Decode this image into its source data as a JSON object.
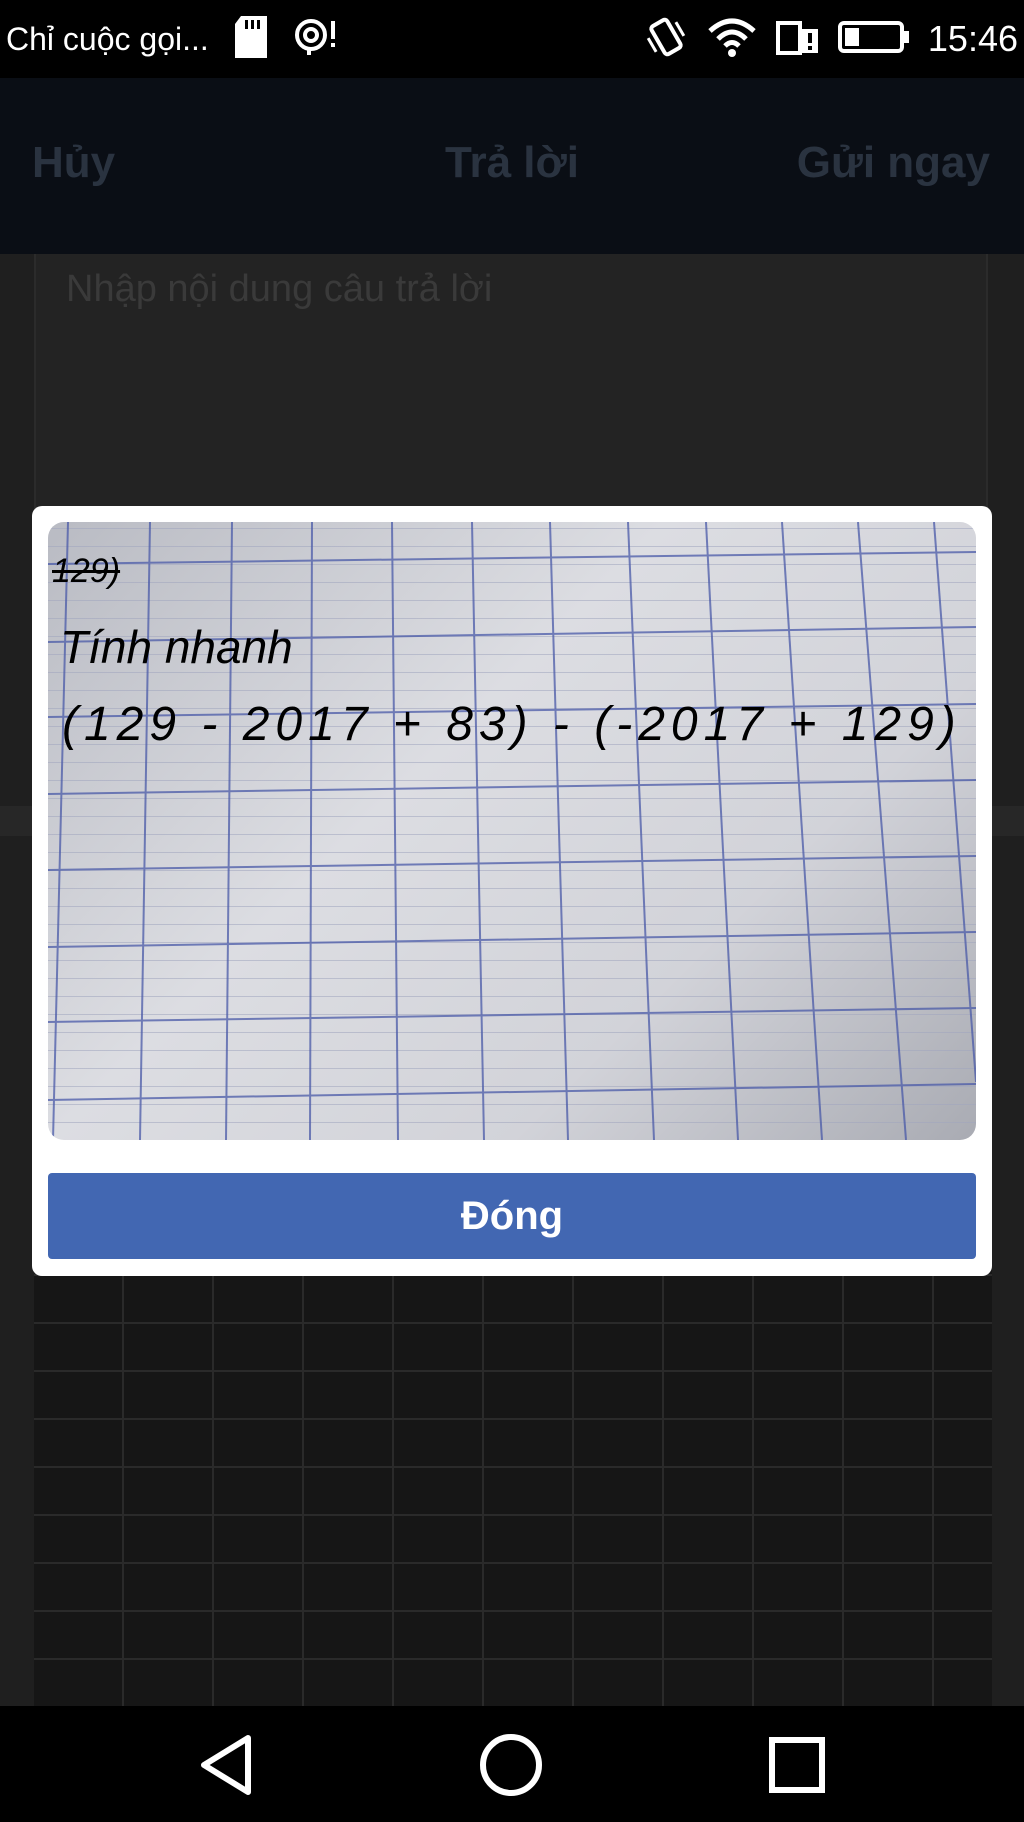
{
  "status_bar": {
    "notification_text": "Chỉ cuộc gọi...",
    "time": "15:46",
    "icons": [
      "sd-card-icon",
      "hotspot-icon",
      "vibrate-icon",
      "wifi-icon",
      "sim-icon",
      "battery-icon"
    ]
  },
  "background_screen": {
    "cancel_label": "Hủy",
    "title": "Trả lời",
    "send_label": "Gửi ngay",
    "answer_placeholder": "Nhập nội dung câu trả lời"
  },
  "modal": {
    "photo": {
      "scribble_text": "129)",
      "title_text": "Tính nhanh",
      "expression_text": "(129 - 2017 + 83) - (-2017 + 129)"
    },
    "close_label": "Đóng",
    "button_color": "#4267b2"
  },
  "nav_bar": {
    "icons": [
      "back-icon",
      "home-icon",
      "recents-icon"
    ]
  }
}
